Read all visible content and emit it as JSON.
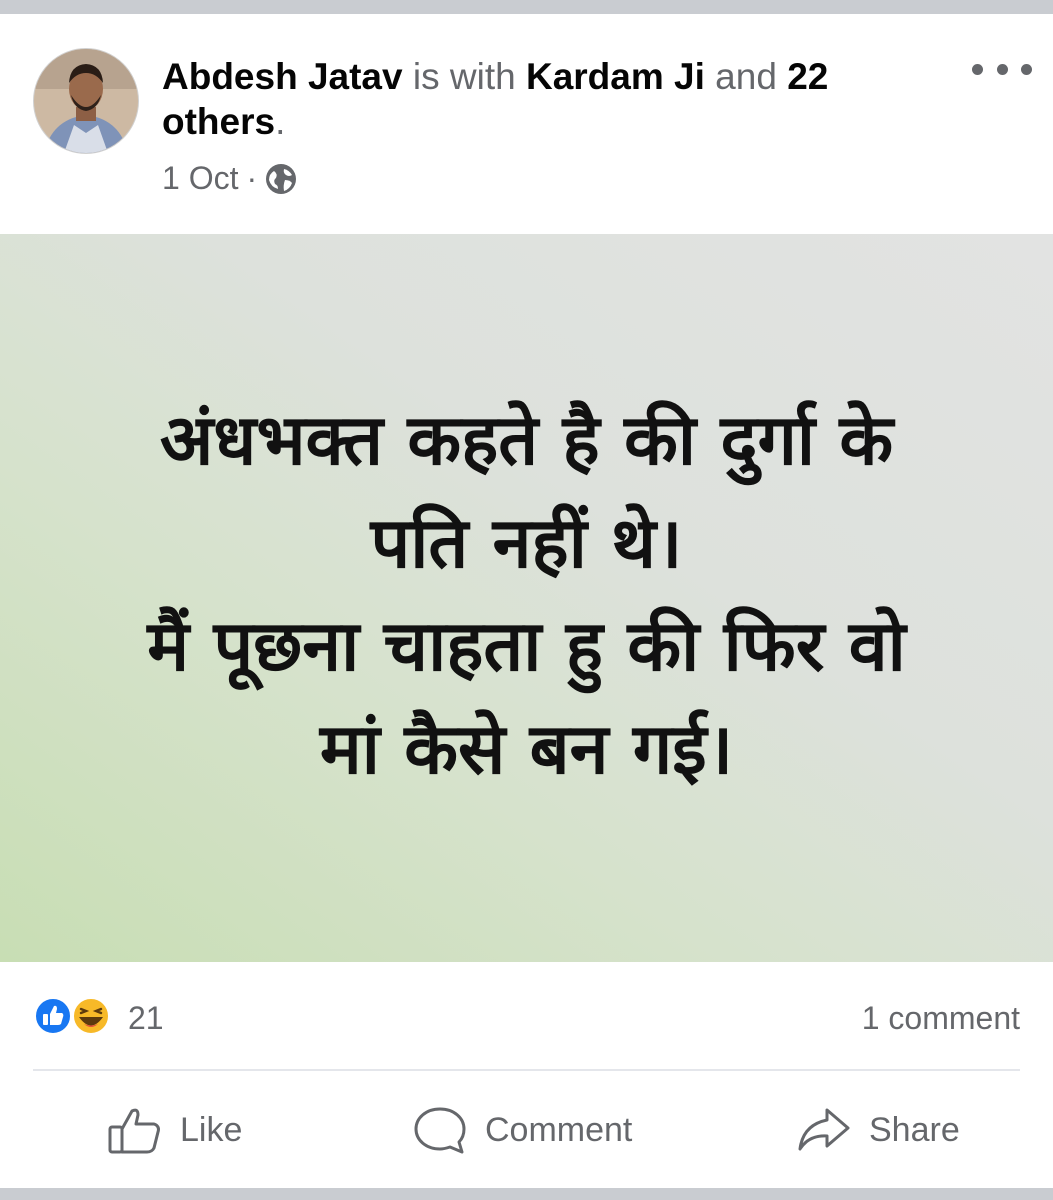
{
  "post": {
    "author": "Abdesh Jatav",
    "with_text": "is with",
    "tagged": "Kardam Ji",
    "and_text": "and",
    "others": "22 others",
    "period": ".",
    "date": "1 Oct",
    "separator": "·",
    "privacy_icon": "globe-icon",
    "menu_icon": "more-options-icon"
  },
  "image": {
    "lines": [
      "अंधभक्त कहते है की दुर्गा के",
      "पति नहीं थे।",
      "मैं पूछना चाहता हु की फिर वो",
      "मां कैसे बन गई।"
    ]
  },
  "stats": {
    "reaction_icons": [
      "like-reaction-icon",
      "haha-reaction-icon"
    ],
    "reaction_count": "21",
    "comment_count": "1 comment"
  },
  "actions": {
    "like": "Like",
    "comment": "Comment",
    "share": "Share"
  },
  "colors": {
    "like_blue": "#1877f2",
    "haha_yellow": "#f7b928",
    "secondary_text": "#65676b"
  }
}
